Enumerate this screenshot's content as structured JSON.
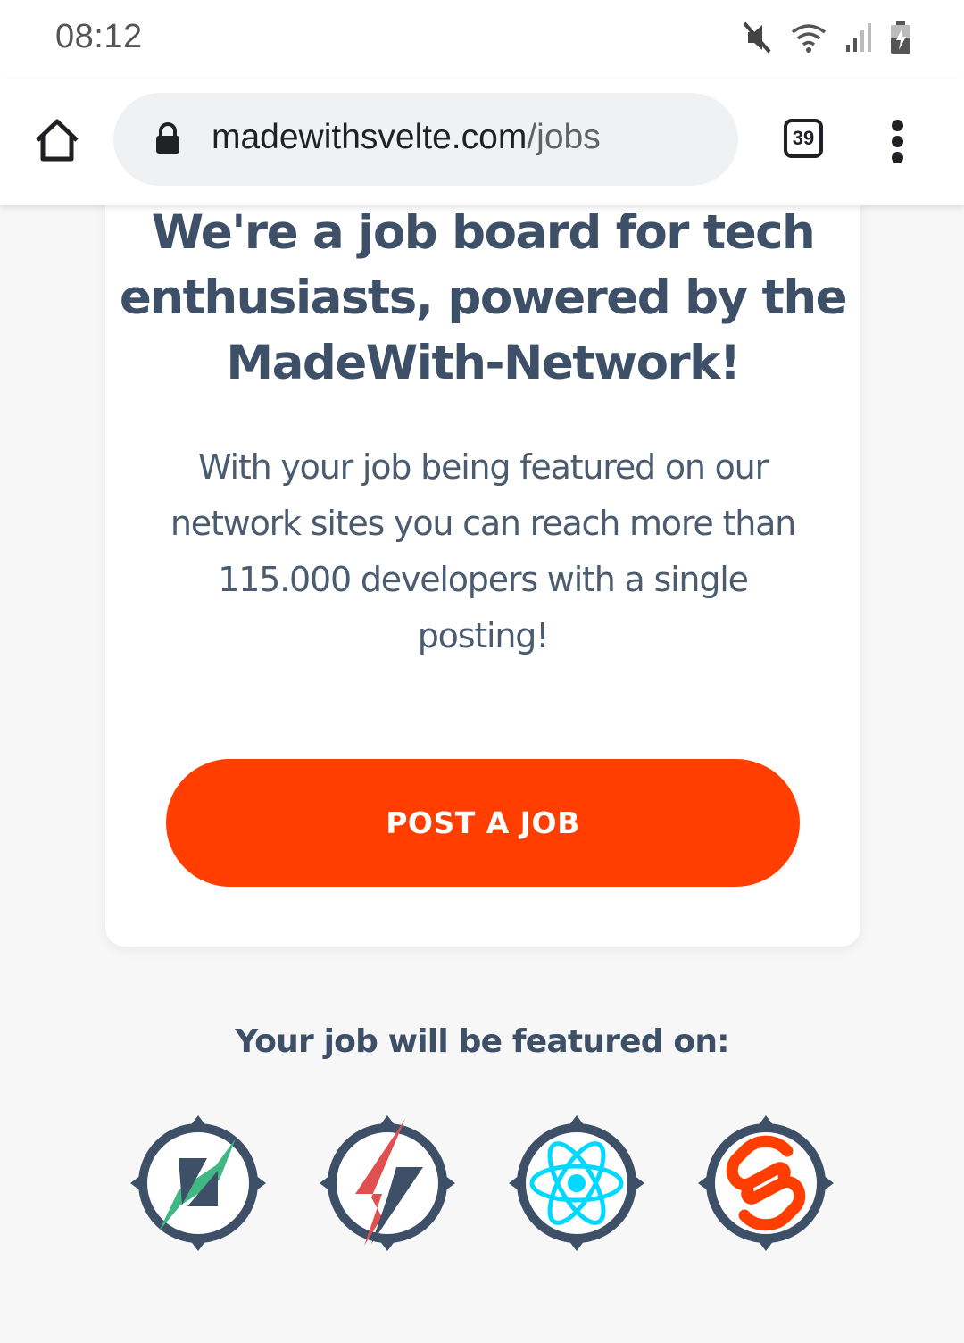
{
  "status_bar": {
    "time": "08:12",
    "icons": [
      "mute-icon",
      "wifi-icon",
      "signal-icon",
      "battery-charging-icon"
    ]
  },
  "browser": {
    "url_host": "madewithsvelte.com",
    "url_path": "/jobs",
    "tab_count": "39",
    "icons": [
      "home-icon",
      "lock-icon",
      "tabs-icon",
      "more-vert-icon"
    ]
  },
  "hero": {
    "headline": "We're a job board for tech enthusiasts, powered by the MadeWith-Network!",
    "subtext": "With your job being featured on our network sites you can reach more than 115.000 developers with a single posting!",
    "cta_label": "POST A JOB"
  },
  "featured": {
    "title": "Your job will be featured on:",
    "logos": [
      {
        "icon": "vue-network-logo-icon",
        "accent": "#41b883"
      },
      {
        "icon": "angular-network-logo-icon",
        "accent": "#e05050"
      },
      {
        "icon": "react-network-logo-icon",
        "accent": "#00d8ff"
      },
      {
        "icon": "svelte-network-logo-icon",
        "accent": "#ff3e00"
      }
    ]
  },
  "colors": {
    "accent": "#ff3e00",
    "heading": "#3d5068",
    "body_text": "#4c5c70",
    "page_bg": "#f7f7f7",
    "logo_ring": "#3d5068"
  }
}
